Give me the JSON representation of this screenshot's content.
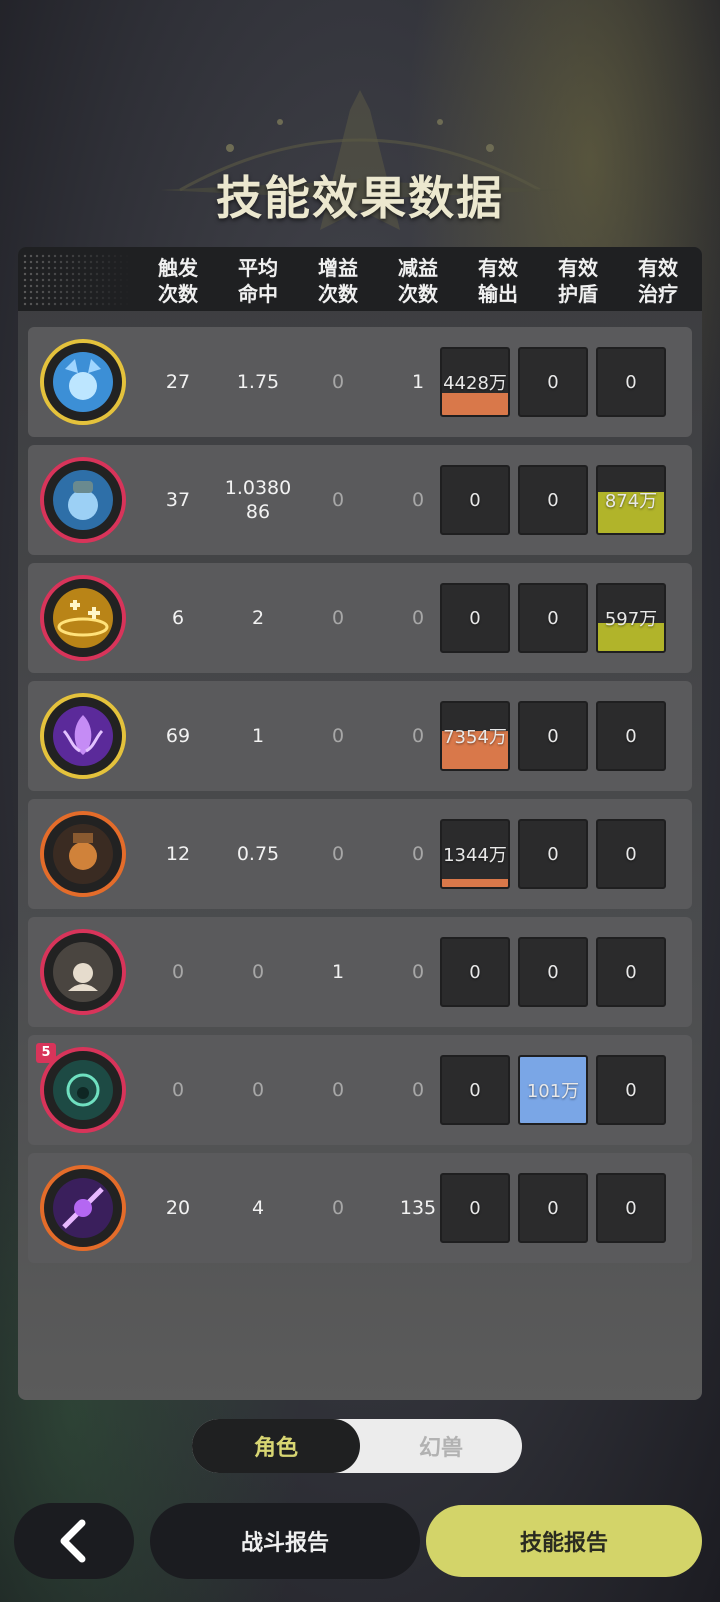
{
  "title": "技能效果数据",
  "headers": [
    {
      "line1": "触发",
      "line2": "次数"
    },
    {
      "line1": "平均",
      "line2": "命中"
    },
    {
      "line1": "增益",
      "line2": "次数"
    },
    {
      "line1": "减益",
      "line2": "次数"
    },
    {
      "line1": "有效",
      "line2": "输出"
    },
    {
      "line1": "有效",
      "line2": "护盾"
    },
    {
      "line1": "有效",
      "line2": "治疗"
    }
  ],
  "rows": [
    {
      "icon": "ice-wolf-skill-icon",
      "frame": "#e4c23c",
      "triggers": "27",
      "avg_hit": "1.75",
      "buffs": "0",
      "debuffs": "1",
      "output": {
        "label": "4428万",
        "level": 0.34
      },
      "shield": {
        "label": "0",
        "level": 0
      },
      "heal": {
        "label": "0",
        "level": 0
      }
    },
    {
      "icon": "ice-bear-skill-icon",
      "frame": "#d8345a",
      "triggers": "37",
      "avg_hit": "1.0380\n86",
      "buffs": "0",
      "debuffs": "0",
      "output": {
        "label": "0",
        "level": 0
      },
      "shield": {
        "label": "0",
        "level": 0
      },
      "heal": {
        "label": "874万",
        "level": 0.62
      }
    },
    {
      "icon": "golden-heal-skill-icon",
      "frame": "#d8345a",
      "triggers": "6",
      "avg_hit": "2",
      "buffs": "0",
      "debuffs": "0",
      "output": {
        "label": "0",
        "level": 0
      },
      "shield": {
        "label": "0",
        "level": 0
      },
      "heal": {
        "label": "597万",
        "level": 0.42
      }
    },
    {
      "icon": "purple-flame-skill-icon",
      "frame": "#e4c23c",
      "triggers": "69",
      "avg_hit": "1",
      "buffs": "0",
      "debuffs": "0",
      "output": {
        "label": "7354万",
        "level": 0.58
      },
      "shield": {
        "label": "0",
        "level": 0
      },
      "heal": {
        "label": "0",
        "level": 0
      }
    },
    {
      "icon": "fire-beast-skill-icon",
      "frame": "#e46c2a",
      "triggers": "12",
      "avg_hit": "0.75",
      "buffs": "0",
      "debuffs": "0",
      "output": {
        "label": "1344万",
        "level": 0.12
      },
      "shield": {
        "label": "0",
        "level": 0
      },
      "heal": {
        "label": "0",
        "level": 0
      }
    },
    {
      "icon": "stone-guardian-skill-icon",
      "frame": "#d8345a",
      "triggers": "0",
      "avg_hit": "0",
      "buffs": "1",
      "debuffs": "0",
      "output": {
        "label": "0",
        "level": 0
      },
      "shield": {
        "label": "0",
        "level": 0
      },
      "heal": {
        "label": "0",
        "level": 0
      }
    },
    {
      "icon": "green-spirit-skill-icon",
      "frame": "#d8345a",
      "badge": "5",
      "triggers": "0",
      "avg_hit": "0",
      "buffs": "0",
      "debuffs": "0",
      "output": {
        "label": "0",
        "level": 0
      },
      "shield": {
        "label": "101万",
        "level": 1
      },
      "heal": {
        "label": "0",
        "level": 0
      }
    },
    {
      "icon": "violet-blade-skill-icon",
      "frame": "#e46c2a",
      "triggers": "20",
      "avg_hit": "4",
      "buffs": "0",
      "debuffs": "135",
      "output": {
        "label": "0",
        "level": 0
      },
      "shield": {
        "label": "0",
        "level": 0
      },
      "heal": {
        "label": "0",
        "level": 0
      }
    }
  ],
  "colors": {
    "output": "#d9784a",
    "shield": "#7aa6e6",
    "heal": "#b1b42a"
  },
  "toggle": {
    "active": "角色",
    "inactive": "幻兽"
  },
  "bottom": {
    "back_icon": "chevron-left-icon",
    "battle_report": "战斗报告",
    "skill_report": "技能报告"
  }
}
